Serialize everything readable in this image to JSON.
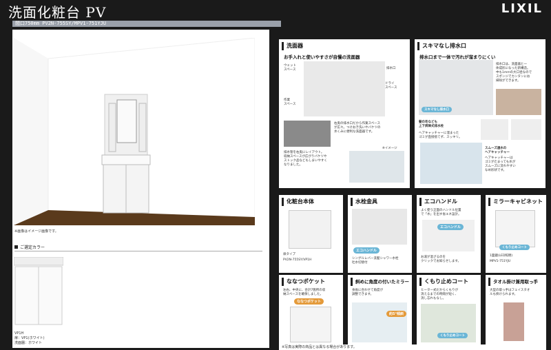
{
  "header": {
    "title": "洗面化粧台 PV",
    "logo": "LIXIL",
    "model": "間口750mm PV2N-755SY/MPV1-751YJU"
  },
  "left": {
    "caption": "※画像はイメージ画像です。",
    "section": "ご選定カラー",
    "swatch_model": "VP1H",
    "swatch_line1": "扉：VP1(ホワイト)",
    "swatch_line2": "洗面器：ホワイト"
  },
  "panels": {
    "basin": {
      "title": "洗面器",
      "sub": "お手入れと使いやすさが自慢の洗面器",
      "l1": "ウェット\nスペース",
      "l2": "作業\nスペース",
      "l3": "排水口",
      "l4": "ドライ\nスペース",
      "t1": "右奥の排水口だから作業スペース\nが広々。つけおき洗いやバケツの\n水くみに便利な洗面器です。",
      "t2": "排水管を右奥にレイアウト。\n収納スペースが広がりバケツや\nストック品などもしまいやすく\nなりました。",
      "img_note": "※イメージ"
    },
    "drain": {
      "title": "スキマなし排水口",
      "sub": "排水口まで一体で汚れが溜まりにくい",
      "t1": "排水口は、洗面器と一\n体成形になった新構造。\n中も1mmの大口径なので\nスポンジでカンタンにお\n掃除ができます。",
      "t2": "髪の毛なども\n上下昇降式排水栓",
      "t3": "ヘアキャッチャーに溜まった\nゴミが直接捨てず、スッキリ。",
      "t4": "スムーズ通水の\nヘアキャッチャー",
      "t5": "ヘアキャッチャーは\nゴミがたまっても水が\nスムーズに流れやすい\nなめ形状です。",
      "badge": "スキマなし排水口"
    },
    "cabinet": {
      "title": "化粧台本体",
      "t1": "扉タイプ",
      "t2": "PV2N-755SY/VP1H"
    },
    "faucet": {
      "title": "水栓金具",
      "badge": "エコハンドル",
      "t1": "シングルレバー洗髪シャワー水栓\n吐水切替付"
    },
    "eco": {
      "title": "エコハンドル",
      "t1": "よく使う正面のハンドル位置\nで「水」を出す省エネ設計。",
      "t2": "お湯が混ざるのを\nクリックでお知らせします。",
      "badge": "エコハンドル"
    },
    "mirror": {
      "title": "ミラーキャビネット",
      "t1": "1面鏡(LED照明)",
      "t2": "MPV1-751YJU",
      "badge": "くもり止めコート"
    },
    "pocket": {
      "title": "ななつポケット",
      "t1": "左右、中央に、合計7箇所の収\n納スペースを確保しました。",
      "badge": "ななつポケット"
    },
    "tilt": {
      "title": "斜めに角度の付いたミラー",
      "t1": "身長に合わせて角度が\n調整できます。",
      "badge": "約5°傾斜"
    },
    "fog": {
      "title": "くもり止めコート",
      "t1": "ヒーター式だからくもりが\n消えるまでの時間が短く、\n消し忘れもなし。",
      "badge": "くもり止めコート"
    },
    "towel": {
      "title": "タオル掛け兼用取っ手",
      "t1": "大型の取っ手はフェイスタオ\nルも掛けられます。"
    }
  },
  "footnote": "※写真は実際の商品とは異なる場合があります。"
}
